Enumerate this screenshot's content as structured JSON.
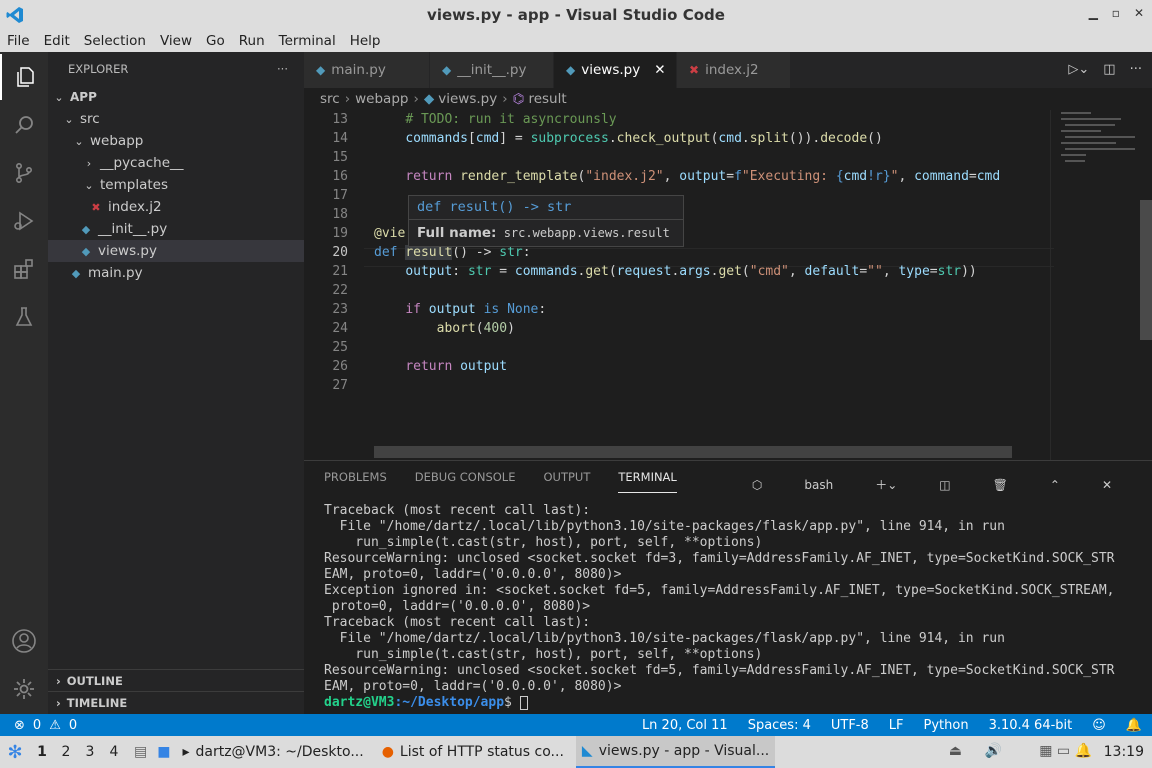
{
  "window": {
    "title": "views.py - app - Visual Studio Code"
  },
  "menu": [
    "File",
    "Edit",
    "Selection",
    "View",
    "Go",
    "Run",
    "Terminal",
    "Help"
  ],
  "explorer": {
    "header": "EXPLORER",
    "root": "APP",
    "items": [
      {
        "label": "src"
      },
      {
        "label": "webapp"
      },
      {
        "label": "__pycache__"
      },
      {
        "label": "templates"
      },
      {
        "label": "index.j2"
      },
      {
        "label": "__init__.py"
      },
      {
        "label": "views.py"
      },
      {
        "label": "main.py"
      }
    ],
    "outline": "OUTLINE",
    "timeline": "TIMELINE"
  },
  "tabs": [
    {
      "label": "main.py"
    },
    {
      "label": "__init__.py"
    },
    {
      "label": "views.py"
    },
    {
      "label": "index.j2"
    }
  ],
  "breadcrumb": [
    "src",
    "webapp",
    "views.py",
    "result"
  ],
  "editor": {
    "line_numbers": [
      "13",
      "14",
      "15",
      "16",
      "17",
      "18",
      "19",
      "20",
      "21",
      "22",
      "23",
      "24",
      "25",
      "26",
      "27"
    ]
  },
  "hover": {
    "signature": "def result() -> str",
    "full_label": "Full name:",
    "full_value": "src.webapp.views.result"
  },
  "panel": {
    "tabs": [
      "PROBLEMS",
      "DEBUG CONSOLE",
      "OUTPUT",
      "TERMINAL"
    ],
    "shell": "bash"
  },
  "terminal": {
    "lines": [
      "Traceback (most recent call last):",
      "  File \"/home/dartz/.local/lib/python3.10/site-packages/flask/app.py\", line 914, in run",
      "    run_simple(t.cast(str, host), port, self, **options)",
      "ResourceWarning: unclosed <socket.socket fd=3, family=AddressFamily.AF_INET, type=SocketKind.SOCK_STR",
      "EAM, proto=0, laddr=('0.0.0.0', 8080)>",
      "Exception ignored in: <socket.socket fd=5, family=AddressFamily.AF_INET, type=SocketKind.SOCK_STREAM,",
      " proto=0, laddr=('0.0.0.0', 8080)>",
      "Traceback (most recent call last):",
      "  File \"/home/dartz/.local/lib/python3.10/site-packages/flask/app.py\", line 914, in run",
      "    run_simple(t.cast(str, host), port, self, **options)",
      "ResourceWarning: unclosed <socket.socket fd=5, family=AddressFamily.AF_INET, type=SocketKind.SOCK_STR",
      "EAM, proto=0, laddr=('0.0.0.0', 8080)>"
    ],
    "prompt_user": "dartz@VM3",
    "prompt_path": ":~/Desktop/app",
    "prompt_sym": "$ "
  },
  "status": {
    "errors": "0",
    "warnings": "0",
    "position": "Ln 20, Col 11",
    "spaces": "Spaces: 4",
    "encoding": "UTF-8",
    "eol": "LF",
    "language": "Python",
    "interpreter": "3.10.4 64-bit"
  },
  "taskbar": {
    "workspaces": [
      "1",
      "2",
      "3",
      "4"
    ],
    "tasks": [
      "dartz@VM3: ~/Deskto...",
      "List of HTTP status co...",
      "views.py - app - Visual..."
    ],
    "clock": "13:19"
  },
  "colors": {
    "accent": "#007acc",
    "python_icon": "#519aba",
    "jinja_icon": "#cc3e44"
  }
}
